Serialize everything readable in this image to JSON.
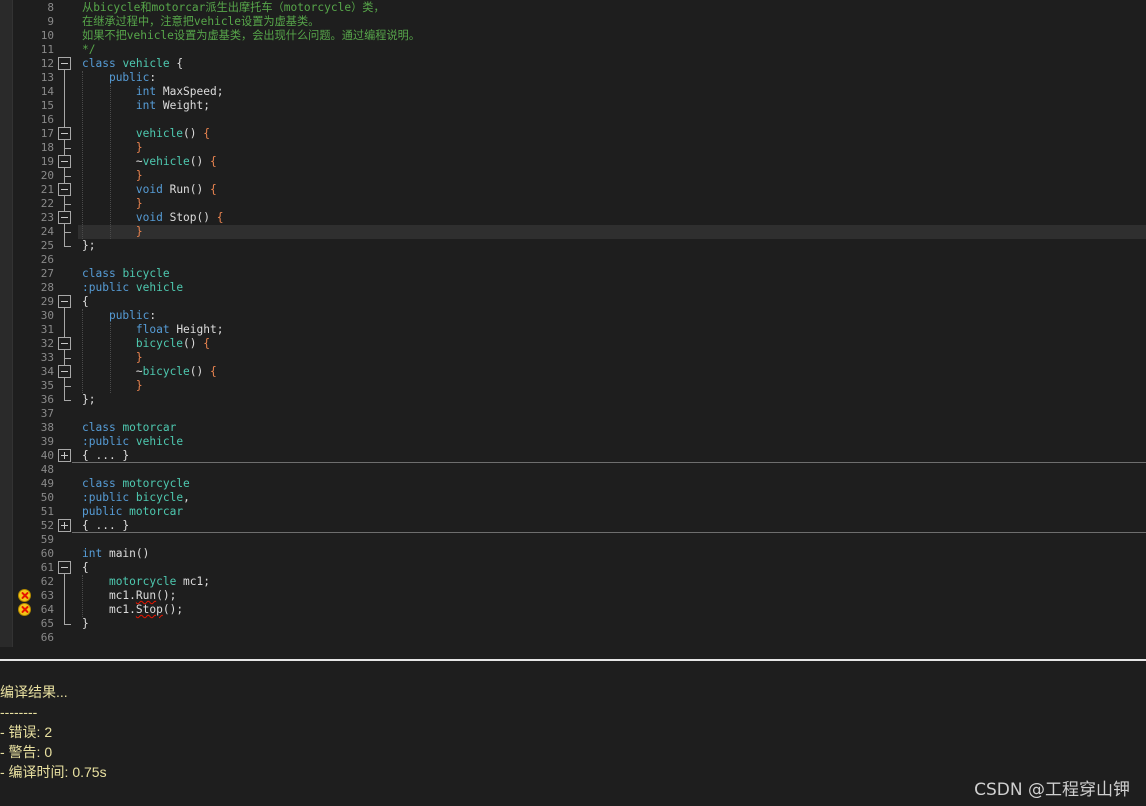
{
  "editor": {
    "lines": [
      {
        "n": 8,
        "tokens": [
          [
            "cmt",
            "从bicycle和motorcar派生出摩托车（motorcycle）类，"
          ]
        ]
      },
      {
        "n": 9,
        "tokens": [
          [
            "cmt",
            "在继承过程中，注意把vehicle设置为虚基类。"
          ]
        ]
      },
      {
        "n": 10,
        "tokens": [
          [
            "cmt",
            "如果不把vehicle设置为虚基类，会出现什么问题。通过编程说明。"
          ]
        ]
      },
      {
        "n": 11,
        "tokens": [
          [
            "cmt",
            "*/"
          ]
        ]
      },
      {
        "n": 12,
        "tokens": [
          [
            "kw",
            "class"
          ],
          [
            "txt",
            " "
          ],
          [
            "tp",
            "vehicle"
          ],
          [
            "txt",
            " {"
          ]
        ],
        "fold": "minus"
      },
      {
        "n": 13,
        "tokens": [
          [
            "txt",
            "    "
          ],
          [
            "kw",
            "public"
          ],
          [
            "txt",
            ":"
          ]
        ]
      },
      {
        "n": 14,
        "tokens": [
          [
            "txt",
            "        "
          ],
          [
            "kw",
            "int"
          ],
          [
            "txt",
            " MaxSpeed;"
          ]
        ]
      },
      {
        "n": 15,
        "tokens": [
          [
            "txt",
            "        "
          ],
          [
            "kw",
            "int"
          ],
          [
            "txt",
            " Weight;"
          ]
        ]
      },
      {
        "n": 16,
        "tokens": []
      },
      {
        "n": 17,
        "tokens": [
          [
            "txt",
            "        "
          ],
          [
            "tp",
            "vehicle"
          ],
          [
            "txt",
            "() "
          ],
          [
            "br",
            "{"
          ]
        ],
        "fold": "minus"
      },
      {
        "n": 18,
        "tokens": [
          [
            "txt",
            "        "
          ],
          [
            "br",
            "}"
          ]
        ]
      },
      {
        "n": 19,
        "tokens": [
          [
            "txt",
            "        ~"
          ],
          [
            "tp",
            "vehicle"
          ],
          [
            "txt",
            "() "
          ],
          [
            "br",
            "{"
          ]
        ],
        "fold": "minus"
      },
      {
        "n": 20,
        "tokens": [
          [
            "txt",
            "        "
          ],
          [
            "br",
            "}"
          ]
        ]
      },
      {
        "n": 21,
        "tokens": [
          [
            "txt",
            "        "
          ],
          [
            "kw",
            "void"
          ],
          [
            "txt",
            " Run() "
          ],
          [
            "br",
            "{"
          ]
        ],
        "fold": "minus"
      },
      {
        "n": 22,
        "tokens": [
          [
            "txt",
            "        "
          ],
          [
            "br",
            "}"
          ]
        ]
      },
      {
        "n": 23,
        "tokens": [
          [
            "txt",
            "        "
          ],
          [
            "kw",
            "void"
          ],
          [
            "txt",
            " Stop() "
          ],
          [
            "br",
            "{"
          ]
        ],
        "fold": "minus"
      },
      {
        "n": 24,
        "tokens": [
          [
            "txt",
            "        "
          ],
          [
            "br",
            "}"
          ]
        ],
        "current": true
      },
      {
        "n": 25,
        "tokens": [
          [
            "txt",
            "};"
          ]
        ]
      },
      {
        "n": 26,
        "tokens": []
      },
      {
        "n": 27,
        "tokens": [
          [
            "kw",
            "class"
          ],
          [
            "txt",
            " "
          ],
          [
            "tp",
            "bicycle"
          ]
        ]
      },
      {
        "n": 28,
        "tokens": [
          [
            "kw",
            ":public"
          ],
          [
            "txt",
            " "
          ],
          [
            "tp",
            "vehicle"
          ]
        ]
      },
      {
        "n": 29,
        "tokens": [
          [
            "txt",
            "{"
          ]
        ],
        "fold": "minus"
      },
      {
        "n": 30,
        "tokens": [
          [
            "txt",
            "    "
          ],
          [
            "kw",
            "public"
          ],
          [
            "txt",
            ":"
          ]
        ]
      },
      {
        "n": 31,
        "tokens": [
          [
            "txt",
            "        "
          ],
          [
            "kw",
            "float"
          ],
          [
            "txt",
            " Height;"
          ]
        ]
      },
      {
        "n": 32,
        "tokens": [
          [
            "txt",
            "        "
          ],
          [
            "tp",
            "bicycle"
          ],
          [
            "txt",
            "() "
          ],
          [
            "br",
            "{"
          ]
        ],
        "fold": "minus"
      },
      {
        "n": 33,
        "tokens": [
          [
            "txt",
            "        "
          ],
          [
            "br",
            "}"
          ]
        ]
      },
      {
        "n": 34,
        "tokens": [
          [
            "txt",
            "        ~"
          ],
          [
            "tp",
            "bicycle"
          ],
          [
            "txt",
            "() "
          ],
          [
            "br",
            "{"
          ]
        ],
        "fold": "minus"
      },
      {
        "n": 35,
        "tokens": [
          [
            "txt",
            "        "
          ],
          [
            "br",
            "}"
          ]
        ]
      },
      {
        "n": 36,
        "tokens": [
          [
            "txt",
            "};"
          ]
        ]
      },
      {
        "n": 37,
        "tokens": []
      },
      {
        "n": 38,
        "tokens": [
          [
            "kw",
            "class"
          ],
          [
            "txt",
            " "
          ],
          [
            "tp",
            "motorcar"
          ]
        ]
      },
      {
        "n": 39,
        "tokens": [
          [
            "kw",
            ":public"
          ],
          [
            "txt",
            " "
          ],
          [
            "tp",
            "vehicle"
          ]
        ]
      },
      {
        "n": 40,
        "tokens": [
          [
            "txt",
            "{ ... }"
          ]
        ],
        "fold": "plus"
      },
      {
        "n": 48,
        "tokens": []
      },
      {
        "n": 49,
        "tokens": [
          [
            "kw",
            "class"
          ],
          [
            "txt",
            " "
          ],
          [
            "tp",
            "motorcycle"
          ]
        ]
      },
      {
        "n": 50,
        "tokens": [
          [
            "kw",
            ":public"
          ],
          [
            "txt",
            " "
          ],
          [
            "tp",
            "bicycle"
          ],
          [
            "txt",
            ","
          ]
        ]
      },
      {
        "n": 51,
        "tokens": [
          [
            "kw",
            "public"
          ],
          [
            "txt",
            " "
          ],
          [
            "tp",
            "motorcar"
          ]
        ]
      },
      {
        "n": 52,
        "tokens": [
          [
            "txt",
            "{ ... }"
          ]
        ],
        "fold": "plus"
      },
      {
        "n": 59,
        "tokens": []
      },
      {
        "n": 60,
        "tokens": [
          [
            "kw",
            "int"
          ],
          [
            "txt",
            " main()"
          ]
        ]
      },
      {
        "n": 61,
        "tokens": [
          [
            "txt",
            "{"
          ]
        ],
        "fold": "minus"
      },
      {
        "n": 62,
        "tokens": [
          [
            "txt",
            "    "
          ],
          [
            "tp",
            "motorcycle"
          ],
          [
            "txt",
            " mc1;"
          ]
        ]
      },
      {
        "n": 63,
        "tokens": [
          [
            "txt",
            "    mc1."
          ],
          [
            "err",
            "Run"
          ],
          [
            "txt",
            "();"
          ]
        ],
        "error": true
      },
      {
        "n": 64,
        "tokens": [
          [
            "txt",
            "    mc1."
          ],
          [
            "err",
            "Stop"
          ],
          [
            "txt",
            "();"
          ]
        ],
        "error": true
      },
      {
        "n": 65,
        "tokens": [
          [
            "txt",
            "}"
          ]
        ]
      },
      {
        "n": 66,
        "tokens": []
      }
    ]
  },
  "output": {
    "title": "编译结果...",
    "divider": "--------",
    "errors": "- 错误: 2",
    "warnings": "- 警告: 0",
    "time": "- 编译时间: 0.75s"
  },
  "watermark": "CSDN @工程穿山钾",
  "colors": {
    "keyword": "#569cd6",
    "type": "#4ec9b0",
    "comment": "#57a64a",
    "brace": "#e8834f",
    "error_icon": "#f5c518",
    "output_text": "#e8e0a0"
  }
}
